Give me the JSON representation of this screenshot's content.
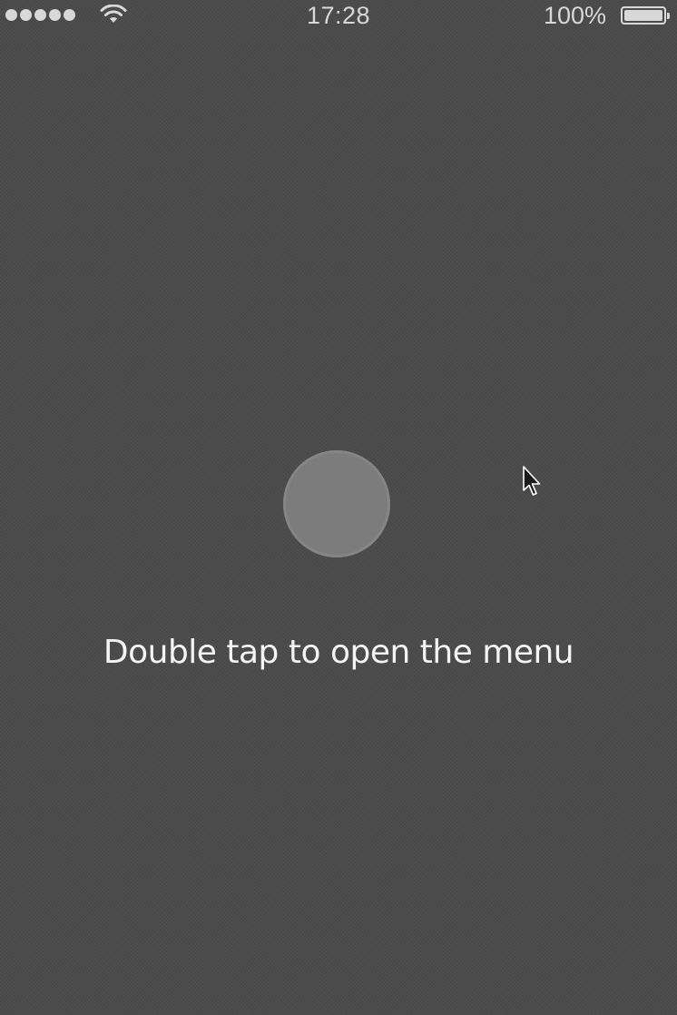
{
  "status_bar": {
    "time": "17:28",
    "battery_percent": "100%",
    "battery_level": 1.0,
    "signal_bars": 5,
    "icons": [
      "signal-dots-icon",
      "wifi-icon",
      "battery-icon"
    ]
  },
  "main": {
    "hint_text": "Double tap to open the menu",
    "button_icon": "circle-button-icon"
  },
  "colors": {
    "background": "#4b4b4b",
    "circle": "#7c7c7c",
    "text": "#f4f4f4"
  },
  "overlay": {
    "cursor_icon": "mouse-pointer-icon"
  }
}
